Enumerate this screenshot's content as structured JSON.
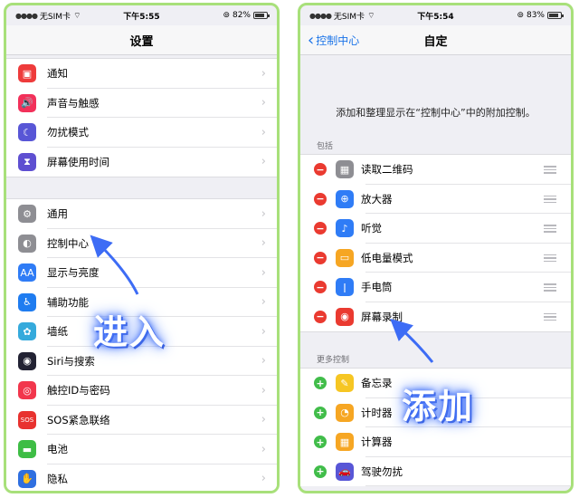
{
  "left": {
    "status": {
      "carrier": "无SIM卡",
      "time": "下午5:55",
      "battery": "82%",
      "battery_level": 0.82
    },
    "title": "设置",
    "group1": [
      {
        "label": "通知",
        "icon": "bell-icon",
        "color": "#ee3b3b",
        "glyph": "▣"
      },
      {
        "label": "声音与触感",
        "icon": "speaker-icon",
        "color": "#f2315a",
        "glyph": "🔊"
      },
      {
        "label": "勿扰模式",
        "icon": "moon-icon",
        "color": "#5856d6",
        "glyph": "☾"
      },
      {
        "label": "屏幕使用时间",
        "icon": "hourglass-icon",
        "color": "#5e4fd1",
        "glyph": "⧗"
      }
    ],
    "group2": [
      {
        "label": "通用",
        "icon": "gear-icon",
        "color": "#8e8e93",
        "glyph": "⚙"
      },
      {
        "label": "控制中心",
        "icon": "toggles-icon",
        "color": "#8e8e93",
        "glyph": "◐"
      },
      {
        "label": "显示与亮度",
        "icon": "text-size-icon",
        "color": "#2f7cf6",
        "glyph": "AA"
      },
      {
        "label": "辅助功能",
        "icon": "accessibility-icon",
        "color": "#1f7cf0",
        "glyph": "♿"
      },
      {
        "label": "墙纸",
        "icon": "flower-icon",
        "color": "#35aadc",
        "glyph": "✿"
      },
      {
        "label": "Siri与搜索",
        "icon": "siri-icon",
        "color": "#222233",
        "glyph": "◉"
      },
      {
        "label": "触控ID与密码",
        "icon": "fingerprint-icon",
        "color": "#f2364c",
        "glyph": "◎"
      },
      {
        "label": "SOS紧急联络",
        "icon": "sos-icon",
        "color": "#e8322f",
        "glyph": "SOS"
      },
      {
        "label": "电池",
        "icon": "battery-icon",
        "color": "#3ebd45",
        "glyph": "▬"
      },
      {
        "label": "隐私",
        "icon": "hand-icon",
        "color": "#2f6fe0",
        "glyph": "✋"
      }
    ],
    "overlay": "进入"
  },
  "right": {
    "status": {
      "carrier": "无SIM卡",
      "time": "下午5:54",
      "battery": "83%",
      "battery_level": 0.83
    },
    "back_label": "控制中心",
    "title": "自定",
    "description": "添加和整理显示在“控制中心”中的附加控制。",
    "include_header": "包括",
    "included": [
      {
        "label": "读取二维码",
        "icon": "qr-scan-icon",
        "color": "#8e8e93",
        "glyph": "▦"
      },
      {
        "label": "放大器",
        "icon": "magnifier-icon",
        "color": "#2f7cf6",
        "glyph": "⊕"
      },
      {
        "label": "听觉",
        "icon": "ear-icon",
        "color": "#2f7cf6",
        "glyph": "♪"
      },
      {
        "label": "低电量模式",
        "icon": "low-power-icon",
        "color": "#f6a623",
        "glyph": "▭"
      },
      {
        "label": "手电筒",
        "icon": "flashlight-icon",
        "color": "#2f7cf6",
        "glyph": "ǀ"
      },
      {
        "label": "屏幕录制",
        "icon": "record-icon",
        "color": "#ea3a30",
        "glyph": "◉"
      }
    ],
    "more_header": "更多控制",
    "more": [
      {
        "label": "备忘录",
        "icon": "notes-icon",
        "color": "#f6c623",
        "glyph": "✎"
      },
      {
        "label": "计时器",
        "icon": "timer-icon",
        "color": "#f6a623",
        "glyph": "◔"
      },
      {
        "label": "计算器",
        "icon": "calculator-icon",
        "color": "#f6a623",
        "glyph": "▦"
      },
      {
        "label": "驾驶勿扰",
        "icon": "car-icon",
        "color": "#5856d6",
        "glyph": "🚗"
      }
    ],
    "overlay": "添加"
  }
}
